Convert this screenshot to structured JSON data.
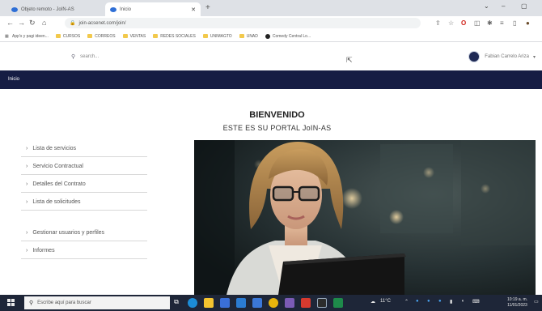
{
  "browser": {
    "tabs": [
      {
        "label": "Objeto remoto - JoIN-AS"
      },
      {
        "label": "Inicio"
      }
    ],
    "url": "join-acsenet.com/join/",
    "bookmarks": [
      {
        "label": "App's y pagi ideen..."
      },
      {
        "label": "CURSOS"
      },
      {
        "label": "CORREOS"
      },
      {
        "label": "VENTAS"
      },
      {
        "label": "REDES SOCIALES"
      },
      {
        "label": "UNIMAGTO"
      },
      {
        "label": "UNAD"
      },
      {
        "label": "Comedy Central Lo..."
      }
    ]
  },
  "site": {
    "search_placeholder": "search...",
    "user_name": "Fabian Carrelo Ariza",
    "nav_label": "Inicio",
    "welcome_title": "BIENVENIDO",
    "welcome_subtitle": "ESTE ES SU PORTAL JoIN-AS",
    "menu": [
      {
        "label": "Lista de servicios"
      },
      {
        "label": "Servicio Contractual"
      },
      {
        "label": "Detalles del Contrato"
      },
      {
        "label": "Lista de solicitudes"
      },
      {
        "label": "Gestionar usuarios y perfiles"
      },
      {
        "label": "Informes"
      }
    ]
  },
  "taskbar": {
    "search_placeholder": "Escribe aquí para buscar",
    "weather": "11°C",
    "time": "10:19 a. m.",
    "date": "11/01/2023"
  },
  "colors": {
    "site_nav": "#161d44",
    "taskbar": "#1e2638",
    "folder": "#f2c94c"
  }
}
